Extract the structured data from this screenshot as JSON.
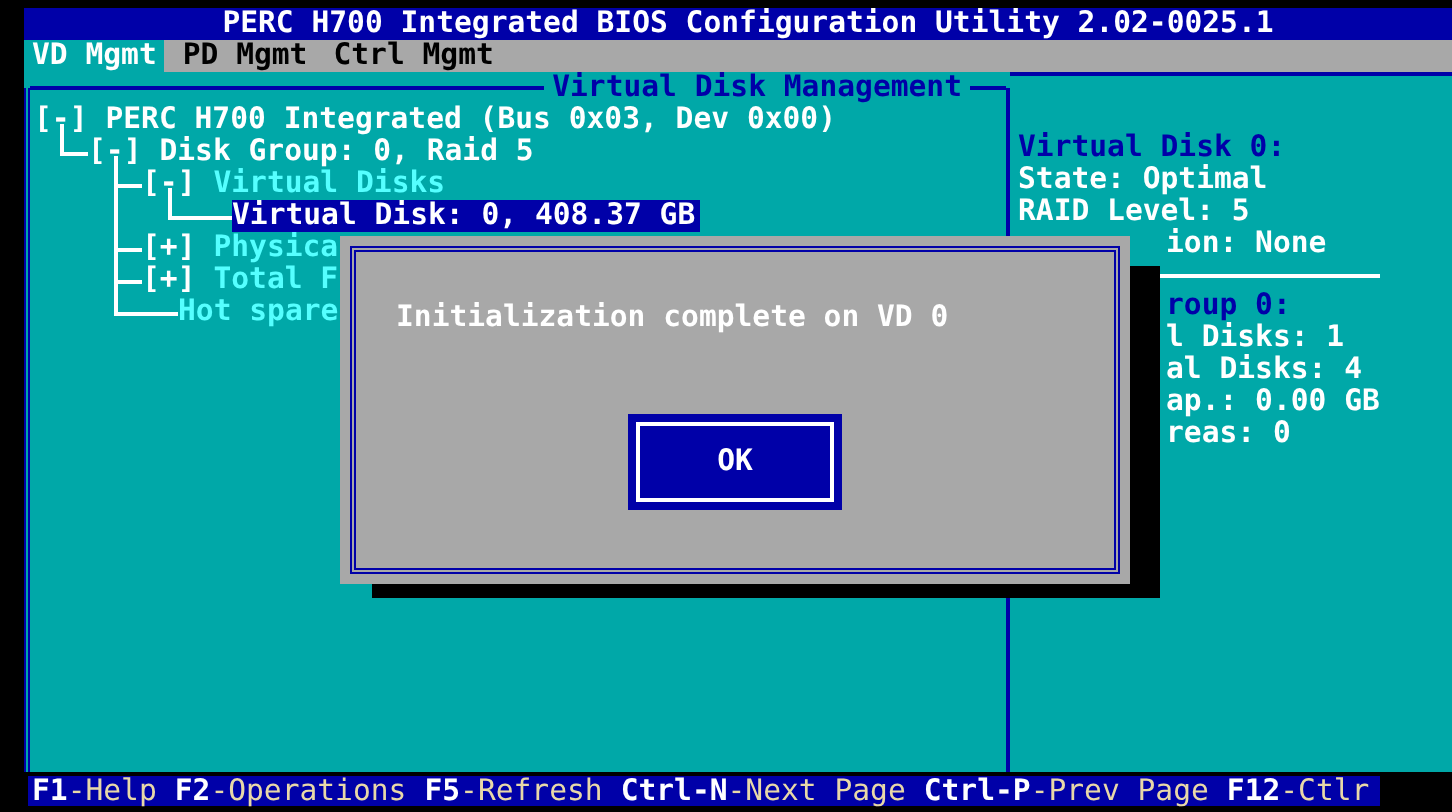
{
  "window": {
    "title": "PERC H700 Integrated BIOS Configuration Utility 2.02-0025.1"
  },
  "tabs": [
    {
      "label": "VD Mgmt",
      "selected": true
    },
    {
      "label": "PD Mgmt",
      "selected": false
    },
    {
      "label": "Ctrl Mgmt",
      "selected": false
    }
  ],
  "panel": {
    "title": "Virtual Disk Management"
  },
  "tree": [
    {
      "toggle": "[-]",
      "label": "PERC H700 Integrated (Bus 0x03, Dev 0x00)",
      "kind": "node",
      "selected": false,
      "children": [
        {
          "toggle": "[-]",
          "label": "Disk Group: 0, Raid 5",
          "kind": "node",
          "selected": false,
          "children": [
            {
              "toggle": "[-]",
              "label": "Virtual Disks",
              "kind": "category",
              "selected": false,
              "children": [
                {
                  "label": "Virtual Disk: 0, 408.37 GB",
                  "kind": "item",
                  "selected": true
                }
              ]
            },
            {
              "toggle": "[+]",
              "label": "Physica",
              "kind": "category",
              "selected": false
            },
            {
              "toggle": "[+]",
              "label": "Total F",
              "kind": "category",
              "selected": false
            },
            {
              "label": "Hot spare",
              "kind": "category",
              "selected": false
            }
          ]
        }
      ]
    }
  ],
  "details": [
    {
      "text": "Virtual Disk 0:",
      "kind": "heading",
      "covered": false
    },
    {
      "text": "State: Optimal",
      "kind": "field",
      "covered": false
    },
    {
      "text": "RAID Level: 5",
      "kind": "field",
      "covered": false
    },
    {
      "text": "ion: None",
      "kind": "field",
      "covered": true
    },
    {
      "kind": "separator"
    },
    {
      "text": "roup 0:",
      "kind": "heading",
      "covered": true
    },
    {
      "text": "l Disks: 1",
      "kind": "field",
      "covered": true
    },
    {
      "text": "al Disks: 4",
      "kind": "field",
      "covered": true
    },
    {
      "text": "ap.: 0.00 GB",
      "kind": "field",
      "covered": true
    },
    {
      "text": "reas: 0",
      "kind": "field",
      "covered": true
    }
  ],
  "dialog": {
    "message": "Initialization complete on VD 0",
    "button": "OK"
  },
  "status_bar": [
    {
      "key": "F1",
      "label": "-Help"
    },
    {
      "key": "F2",
      "label": "-Operations"
    },
    {
      "key": "F5",
      "label": "-Refresh"
    },
    {
      "key": "Ctrl-N",
      "label": "-Next Page"
    },
    {
      "key": "Ctrl-P",
      "label": "-Prev Page"
    },
    {
      "key": "F12",
      "label": "-Ctlr"
    }
  ]
}
